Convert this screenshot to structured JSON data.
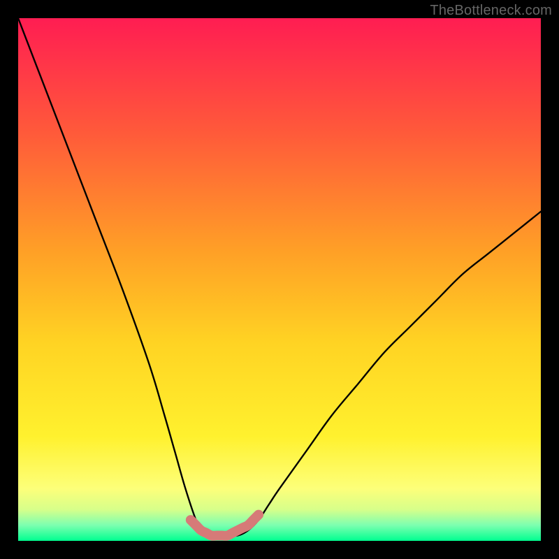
{
  "watermark": "TheBottleneck.com",
  "chart_data": {
    "type": "line",
    "title": "",
    "xlabel": "",
    "ylabel": "",
    "xlim": [
      0,
      100
    ],
    "ylim": [
      0,
      100
    ],
    "series": [
      {
        "name": "bottleneck-curve",
        "x": [
          0,
          5,
          10,
          15,
          20,
          25,
          28,
          30,
          32,
          34,
          35,
          36,
          37,
          38,
          40,
          42,
          44,
          46,
          48,
          50,
          55,
          60,
          65,
          70,
          75,
          80,
          85,
          90,
          95,
          100
        ],
        "y": [
          100,
          87,
          74,
          61,
          48,
          34,
          24,
          17,
          10,
          4,
          2,
          1,
          1,
          1,
          1,
          1,
          2,
          4,
          7,
          10,
          17,
          24,
          30,
          36,
          41,
          46,
          51,
          55,
          59,
          63
        ]
      },
      {
        "name": "optimal-zone-highlight",
        "x": [
          33,
          34,
          35,
          36,
          37,
          38,
          39,
          40,
          41,
          42,
          43,
          44,
          45,
          46
        ],
        "y": [
          4,
          3,
          2,
          1.5,
          1,
          1,
          1,
          1,
          1.5,
          2,
          2.5,
          3,
          4,
          5
        ]
      }
    ],
    "background_gradient": {
      "stops": [
        {
          "offset": 0.0,
          "color": "#ff1d52"
        },
        {
          "offset": 0.22,
          "color": "#ff5a3a"
        },
        {
          "offset": 0.45,
          "color": "#ffa126"
        },
        {
          "offset": 0.62,
          "color": "#ffd323"
        },
        {
          "offset": 0.8,
          "color": "#fff12e"
        },
        {
          "offset": 0.9,
          "color": "#fdff7a"
        },
        {
          "offset": 0.94,
          "color": "#d7ff8a"
        },
        {
          "offset": 0.97,
          "color": "#7dffb0"
        },
        {
          "offset": 1.0,
          "color": "#00ff90"
        }
      ]
    },
    "curve_color": "#000000",
    "highlight_color": "#d67a78"
  }
}
